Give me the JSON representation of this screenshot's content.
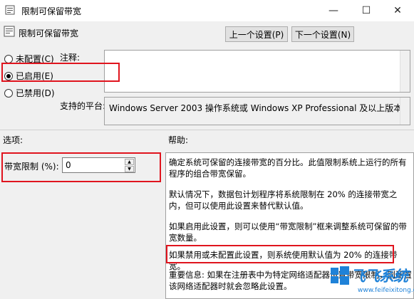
{
  "window": {
    "title": "限制可保留带宽",
    "min_symbol": "—",
    "max_symbol": "☐",
    "close_symbol": "✕"
  },
  "header": {
    "policy_title": "限制可保留带宽",
    "prev_button": "上一个设置(P)",
    "next_button": "下一个设置(N)"
  },
  "state_options": {
    "not_configured": "未配置(C)",
    "enabled": "已启用(E)",
    "disabled": "已禁用(D)",
    "selected": "enabled"
  },
  "comment": {
    "label": "注释:",
    "value": ""
  },
  "supported": {
    "label": "支持的平台:",
    "value": "Windows Server 2003 操作系统或 Windows XP Professional 及以上版本"
  },
  "options": {
    "heading": "选项:",
    "bandwidth_label": "带宽限制 (%):",
    "bandwidth_value": "0"
  },
  "help": {
    "heading": "帮助:",
    "paragraphs": [
      "确定系统可保留的连接带宽的百分比。此值限制系统上运行的所有程序的组合带宽保留。",
      "默认情况下，数据包计划程序将系统限制在 20% 的连接带宽之内，但可以使用此设置来替代默认值。",
      "如果启用此设置，则可以使用“带宽限制”框来调整系统可保留的带宽数量。",
      "如果禁用或未配置此设置，则系统使用默认值为 20% 的连接带宽。",
      "重要信息: 如果在注册表中为特定网络适配器设置带宽限制，则配置该网络适配器时就会忽略此设置。"
    ]
  },
  "watermark": {
    "brand": "飞飞系统",
    "url": "www.feifeixitong.com"
  },
  "colors": {
    "highlight": "#e0141e",
    "watermark": "#1f82d8"
  }
}
